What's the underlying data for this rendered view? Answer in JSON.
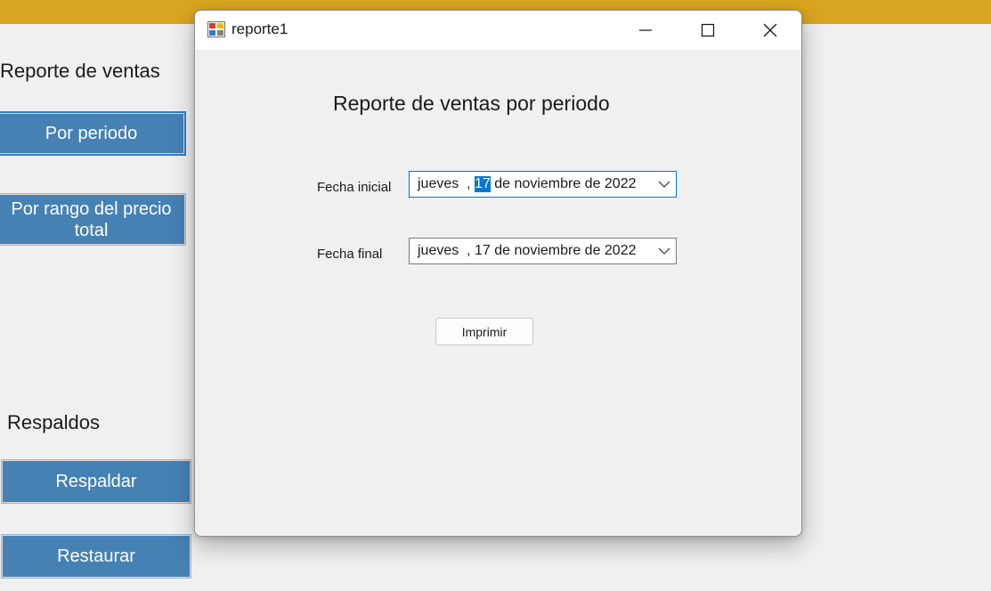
{
  "main_form": {
    "reports_heading": "Reporte de ventas",
    "buttons": {
      "por_periodo": "Por periodo",
      "por_rango_line1": "Por rango del precio",
      "por_rango_line2": "total",
      "respaldar": "Respaldar",
      "restaurar": "Restaurar"
    },
    "backups_heading": "Respaldos",
    "colors": {
      "accent_strip": "#daa520",
      "button_bg": "#4681b4"
    }
  },
  "dialog": {
    "title": "reporte1",
    "heading": "Reporte de ventas por periodo",
    "fecha_inicial": {
      "label": "Fecha inicial",
      "weekday": "jueves",
      "sep1": "  , ",
      "day": "17",
      "rest": " de noviembre de 2022"
    },
    "fecha_final": {
      "label": "Fecha final",
      "weekday": "jueves",
      "sep1": "  , ",
      "day": "17",
      "rest": " de noviembre de 2022"
    },
    "print_label": "Imprimir",
    "icons": [
      "app-icon",
      "minimize-icon",
      "maximize-icon",
      "close-icon",
      "chevron-down-icon"
    ]
  }
}
